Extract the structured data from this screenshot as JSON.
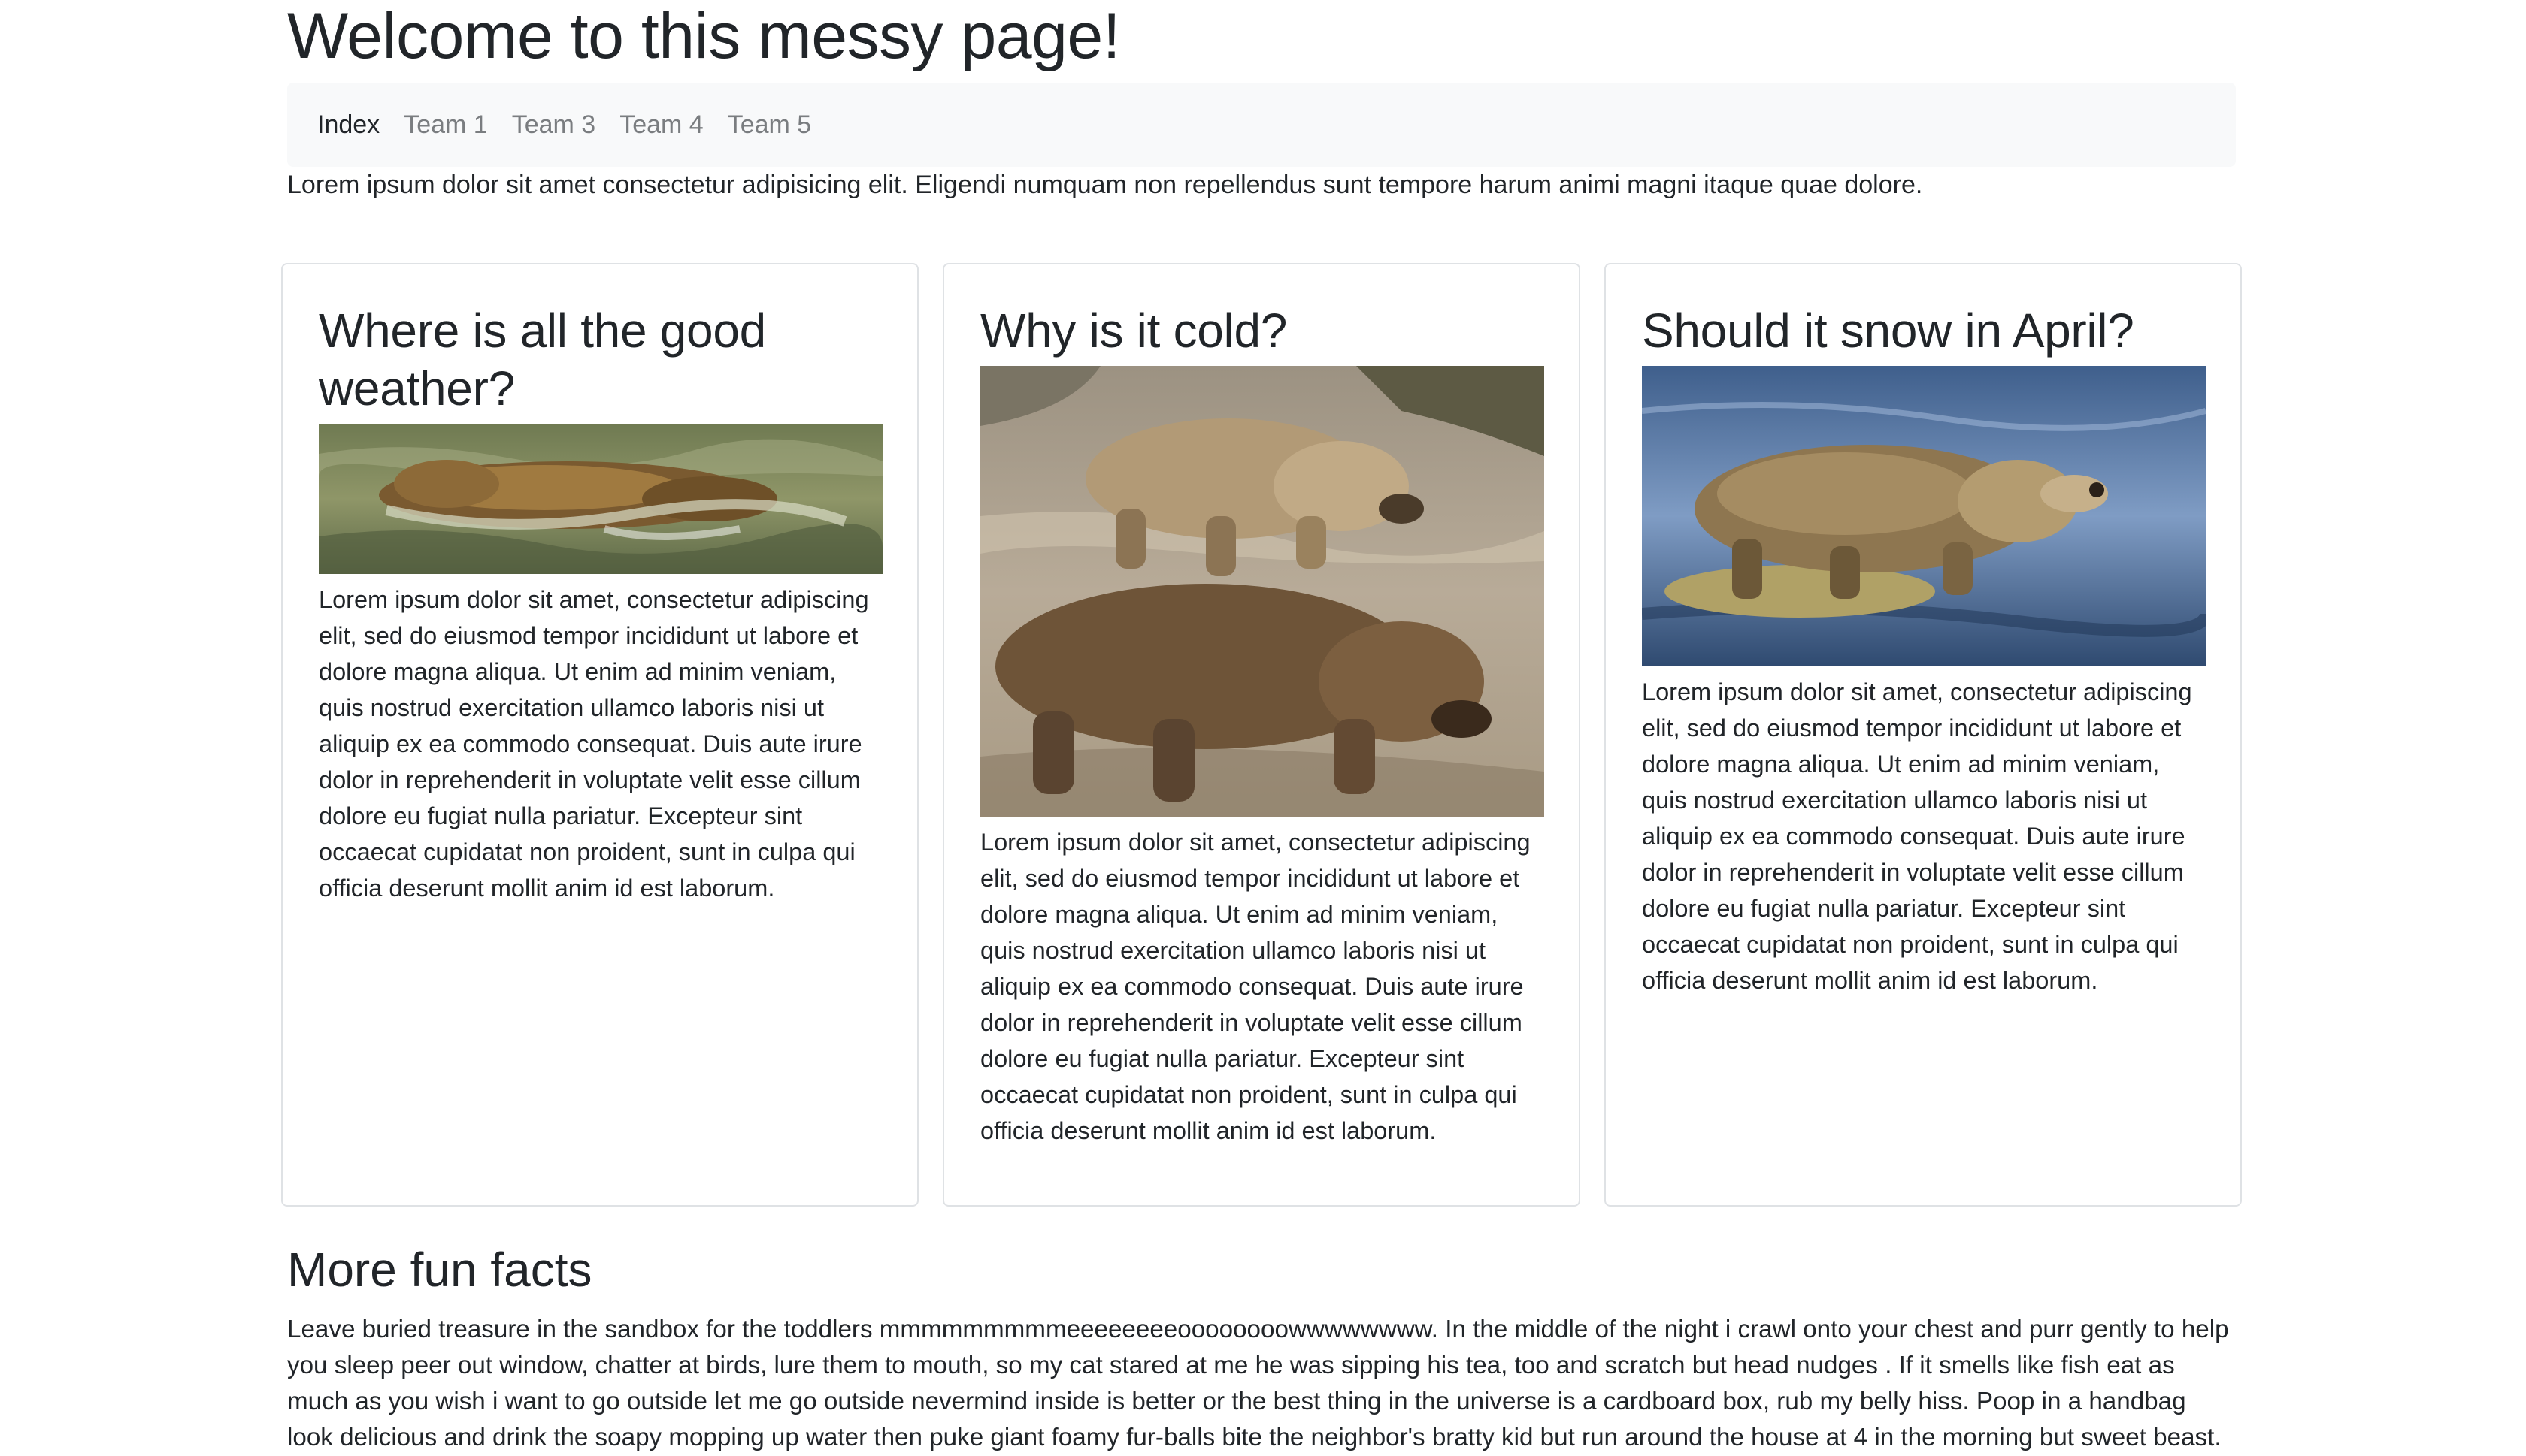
{
  "page": {
    "title": "Welcome to this messy page!",
    "intro": "Lorem ipsum dolor sit amet consectetur adipisicing elit. Eligendi numquam non repellendus sunt tempore harum animi magni itaque quae dolore."
  },
  "nav": {
    "items": [
      {
        "label": "Index",
        "active": true
      },
      {
        "label": "Team 1"
      },
      {
        "label": "Team 3"
      },
      {
        "label": "Team 4"
      },
      {
        "label": "Team 5"
      }
    ]
  },
  "cards": [
    {
      "title": "Where is all the good weather?",
      "image": "bear-swimming-in-river",
      "text": "Lorem ipsum dolor sit amet, consectetur adipiscing elit, sed do eiusmod tempor incididunt ut labore et dolore magna aliqua. Ut enim ad minim veniam, quis nostrud exercitation ullamco laboris nisi ut aliquip ex ea commodo consequat. Duis aute irure dolor in reprehenderit in voluptate velit esse cillum dolore eu fugiat nulla pariatur. Excepteur sint occaecat cupidatat non proident, sunt in culpa qui officia deserunt mollit anim id est laborum."
    },
    {
      "title": "Why is it cold?",
      "image": "two-bears-on-rocks",
      "text": "Lorem ipsum dolor sit amet, consectetur adipiscing elit, sed do eiusmod tempor incididunt ut labore et dolore magna aliqua. Ut enim ad minim veniam, quis nostrud exercitation ullamco laboris nisi ut aliquip ex ea commodo consequat. Duis aute irure dolor in reprehenderit in voluptate velit esse cillum dolore eu fugiat nulla pariatur. Excepteur sint occaecat cupidatat non proident, sunt in culpa qui officia deserunt mollit anim id est laborum."
    },
    {
      "title": "Should it snow in April?",
      "image": "bear-standing-in-water",
      "text": "Lorem ipsum dolor sit amet, consectetur adipiscing elit, sed do eiusmod tempor incididunt ut labore et dolore magna aliqua. Ut enim ad minim veniam, quis nostrud exercitation ullamco laboris nisi ut aliquip ex ea commodo consequat. Duis aute irure dolor in reprehenderit in voluptate velit esse cillum dolore eu fugiat nulla pariatur. Excepteur sint occaecat cupidatat non proident, sunt in culpa qui officia deserunt mollit anim id est laborum."
    }
  ],
  "more": {
    "title": "More fun facts",
    "text": "Leave buried treasure in the sandbox for the toddlers mmmmmmmmmeeeeeeeeoooooooowwwwwwww. In the middle of the night i crawl onto your chest and purr gently to help you sleep peer out window, chatter at birds, lure them to mouth, so my cat stared at me he was sipping his tea, too and scratch but head nudges . If it smells like fish eat as much as you wish i want to go outside let me go outside nevermind inside is better or the best thing in the universe is a cardboard box, rub my belly hiss. Poop in a handbag look delicious and drink the soapy mopping up water then puke giant foamy fur-balls bite the neighbor's bratty kid but run around the house at 4 in the morning but sweet beast."
  }
}
